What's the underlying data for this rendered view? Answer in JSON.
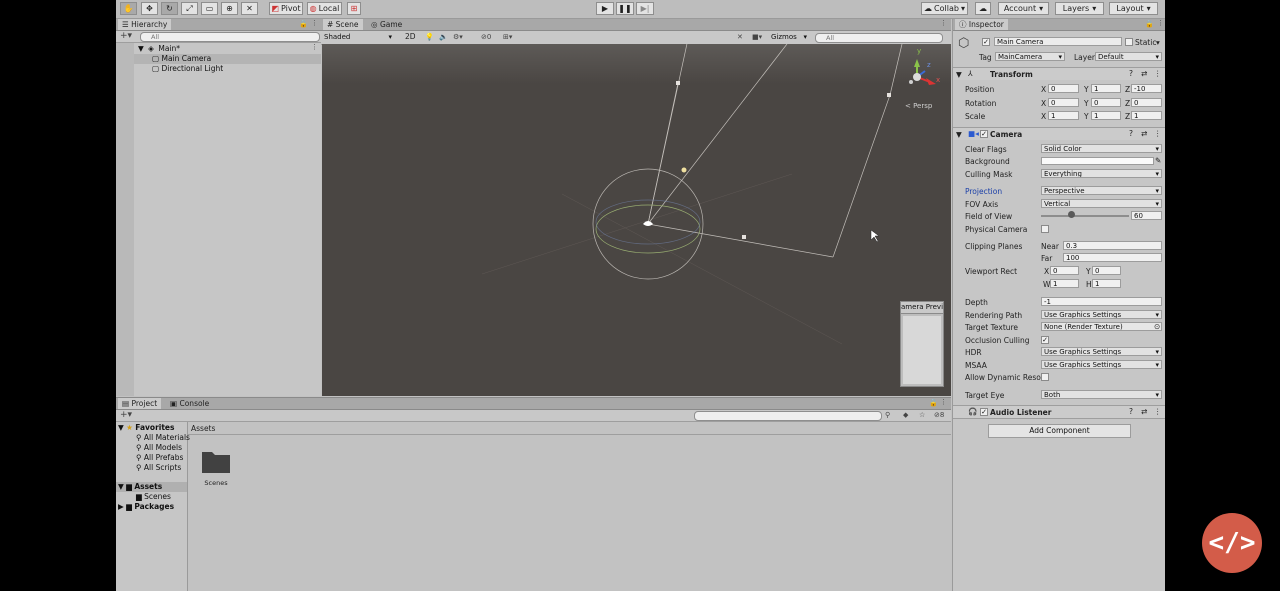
{
  "toolbar": {
    "pivot_label": "Pivot",
    "local_label": "Local",
    "collab_label": "Collab",
    "account_label": "Account",
    "layers_label": "Layers",
    "layout_label": "Layout"
  },
  "hierarchy": {
    "tab_label": "Hierarchy",
    "search_placeholder": "All",
    "scene_name": "Main*",
    "items": [
      "Main Camera",
      "Directional Light"
    ]
  },
  "scene": {
    "tabs": [
      "Scene",
      "Game"
    ],
    "shading_mode": "Shaded",
    "mode_2d": "2D",
    "hidden_count": "0",
    "gizmos_label": "Gizmos",
    "search_placeholder": "All",
    "persp_label": "< Persp",
    "axis_y": "y",
    "axis_z": "z",
    "axis_x": "x",
    "preview_title": "amera Previe"
  },
  "inspector": {
    "tab_label": "Inspector",
    "object_name": "Main Camera",
    "static_label": "Static",
    "tag_label": "Tag",
    "tag_value": "MainCamera",
    "layer_label": "Layer",
    "layer_value": "Default",
    "transform": {
      "title": "Transform",
      "position_label": "Position",
      "rotation_label": "Rotation",
      "scale_label": "Scale",
      "position": {
        "x": "0",
        "y": "1",
        "z": "-10"
      },
      "rotation": {
        "x": "0",
        "y": "0",
        "z": "0"
      },
      "scale": {
        "x": "1",
        "y": "1",
        "z": "1"
      }
    },
    "camera": {
      "title": "Camera",
      "clear_flags_label": "Clear Flags",
      "clear_flags": "Solid Color",
      "background_label": "Background",
      "culling_mask_label": "Culling Mask",
      "culling_mask": "Everything",
      "projection_label": "Projection",
      "projection": "Perspective",
      "fov_axis_label": "FOV Axis",
      "fov_axis": "Vertical",
      "fov_label": "Field of View",
      "fov_value": "60",
      "fov_fraction": 0.34,
      "physical_camera_label": "Physical Camera",
      "clipping_label": "Clipping Planes",
      "near_label": "Near",
      "near_value": "0.3",
      "far_label": "Far",
      "far_value": "100",
      "viewport_label": "Viewport Rect",
      "vp_x": "0",
      "vp_y": "0",
      "vp_w": "1",
      "vp_h": "1",
      "depth_label": "Depth",
      "depth_value": "-1",
      "rendering_path_label": "Rendering Path",
      "rendering_path": "Use Graphics Settings",
      "target_texture_label": "Target Texture",
      "target_texture": "None (Render Texture)",
      "occlusion_label": "Occlusion Culling",
      "hdr_label": "HDR",
      "hdr_value": "Use Graphics Settings",
      "msaa_label": "MSAA",
      "msaa_value": "Use Graphics Settings",
      "dynamic_res_label": "Allow Dynamic Resol",
      "target_eye_label": "Target Eye",
      "target_eye": "Both"
    },
    "audio_listener_title": "Audio Listener",
    "add_component_label": "Add Component"
  },
  "project": {
    "tabs": [
      "Project",
      "Console"
    ],
    "favorites_label": "Favorites",
    "favorites": [
      "All Materials",
      "All Models",
      "All Prefabs",
      "All Scripts"
    ],
    "assets_label": "Assets",
    "asset_children": [
      "Scenes"
    ],
    "packages_label": "Packages",
    "breadcrumb": "Assets",
    "grid_items": [
      "Scenes"
    ],
    "hidden_count": "8"
  },
  "colors": {
    "scene_bg": "#4a4643",
    "accent_fab": "#d35c49",
    "projection_label_color": "#1a3fa8"
  }
}
